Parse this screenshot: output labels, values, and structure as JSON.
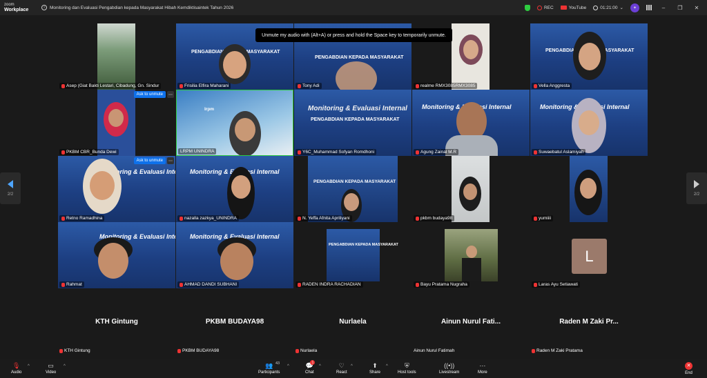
{
  "app": {
    "logo_line1": "zoom",
    "logo_line2": "Workplace"
  },
  "meeting": {
    "title": "Monitoring dan Evaluasi Pengabdian kepada Masyarakat Hibah Kemdiktisaintek Tahun 2026"
  },
  "topbar": {
    "rec_label": "REC",
    "youtube_label": "YouTube",
    "timer": "01:21:00",
    "caret": "⌄"
  },
  "tooltip": {
    "text": "Unmute my audio with (Alt+A) or press and hold the Space key to temporarily unmute."
  },
  "slide": {
    "title": "Monitoring & Evaluasi Internal",
    "subtitle": "PENGABDIAN KEPADA MASYARAKAT",
    "brand": "lrpm"
  },
  "tiles": [
    {
      "name": "Asep (Giat Bakti Lestari, Cibadung, Gn. Sindur"
    },
    {
      "name": "Frisilia Elfira Maharani"
    },
    {
      "name": "Tony Adi"
    },
    {
      "name": "realme RMX3085RMX3085"
    },
    {
      "name": "Vella Anggresta"
    },
    {
      "name": "PKBM CBR_Bunda Dewi"
    },
    {
      "name": "LRPM UNINDRA"
    },
    {
      "name": "Y6C_Muhammad Sofyan Romdhoni"
    },
    {
      "name": "Agung Zainal M.R"
    },
    {
      "name": "Suwaebatul Aslamiyah"
    },
    {
      "name": "Retno Ramadhina"
    },
    {
      "name": "nazalla zazkya_UNINDRA"
    },
    {
      "name": "N. Yeffa Afnita Apriliyani"
    },
    {
      "name": "pkbm budaya98"
    },
    {
      "name": "yumiiii"
    },
    {
      "name": "Rahmat"
    },
    {
      "name": "AHMAD DANDI SUBHANI"
    },
    {
      "name": "RADEN INDRA RACHADIAN"
    },
    {
      "name": "Bayu Pratama Nugraha"
    },
    {
      "name": "Laras Ayu Setiawati"
    }
  ],
  "ask_unmute": "Ask to unmute",
  "laras_initial": "L",
  "pager": {
    "left": "2/2",
    "right": "2/2"
  },
  "audio_only": [
    {
      "big": "KTH Gintung",
      "small": "KTH Gintung"
    },
    {
      "big": "PKBM BUDAYA98",
      "small": "PKBM BUDAYA98"
    },
    {
      "big": "Nurlaela",
      "small": "Nurlaela"
    },
    {
      "big": "Ainun Nurul Fati...",
      "small": "Ainun Nurul Fatimah"
    },
    {
      "big": "Raden M Zaki Pr...",
      "small": "Raden M Zaki Pratama"
    }
  ],
  "toolbar": {
    "audio": "Audio",
    "video": "Video",
    "participants": "Participants",
    "participants_count": "43",
    "chat": "Chat",
    "chat_badge": "1",
    "react": "React",
    "share": "Share",
    "host_tools": "Host tools",
    "livestream": "Livestream",
    "more": "More",
    "end": "End"
  },
  "colors": {
    "slide_blue": "#1d3f82",
    "active_border": "#2ecc40",
    "unmute_blue": "#0e71eb",
    "end_red": "#e33333"
  }
}
